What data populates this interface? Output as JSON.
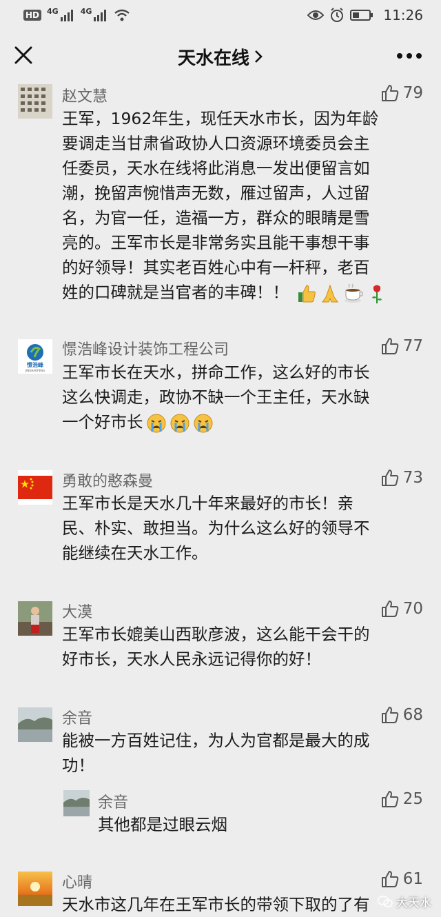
{
  "status_bar": {
    "hd_label": "HD",
    "net1": "4G",
    "net2": "4G",
    "time": "11:26"
  },
  "nav": {
    "title": "天水在线",
    "title_chevron": ">"
  },
  "comments": [
    {
      "name": "赵文慧",
      "likes": "79",
      "lines": [
        "王军，1962年生，现任天水市长，因为年龄",
        "要调走当甘肃省政协人口资源环境委员会主",
        "任委员，天水在线将此消息一发出便留言如",
        "潮，挽留声惋惜声无数，雁过留声，人过留",
        "名，为官一任，造福一方，群众的眼睛是雪",
        "亮的。王军市长是非常务实且能干事想干事",
        "的好领导！其实老百姓心中有一杆秤，老百",
        "姓的口碑就是当官者的丰碑！！"
      ],
      "emoji": [
        "thumbs-up-emoji",
        "praying-hands-emoji",
        "coffee-emoji",
        "rose-emoji"
      ]
    },
    {
      "name": "憬浩峰设计装饰工程公司",
      "likes": "77",
      "avatar_text": "憬浩峰",
      "avatar_subtext": "JINGHAOFENG",
      "lines": [
        "王军市长在天水，拼命工作，这么好的市长",
        "这么快调走，政协不缺一个王主任，天水缺",
        "一个好市长"
      ],
      "emoji": [
        "crying-face-emoji",
        "crying-face-emoji",
        "crying-face-emoji"
      ]
    },
    {
      "name": "勇敢的憨森曼",
      "likes": "73",
      "lines": [
        "王军市长是天水几十年来最好的市长！亲",
        "民、朴实、敢担当。为什么这么好的领导不",
        "能继续在天水工作。"
      ]
    },
    {
      "name": "大漠",
      "likes": "70",
      "lines": [
        "王军市长媲美山西耿彦波，这么能干会干的",
        "好市长，天水人民永远记得你的好！"
      ]
    },
    {
      "name": "余音",
      "likes": "68",
      "lines": [
        "能被一方百姓记住，为人为官都是最大的成",
        "功！"
      ],
      "reply": {
        "name": "余音",
        "likes": "25",
        "lines": [
          "其他都是过眼云烟"
        ]
      }
    },
    {
      "name": "心晴",
      "likes": "61",
      "lines": [
        "天水市这几年在王军市长的带领下取的了有"
      ]
    }
  ],
  "watermark": "大天水",
  "colors": {
    "background": "#ededed",
    "text_primary": "#1b1b1b",
    "text_secondary": "#666666",
    "like_icon": "#555555"
  }
}
